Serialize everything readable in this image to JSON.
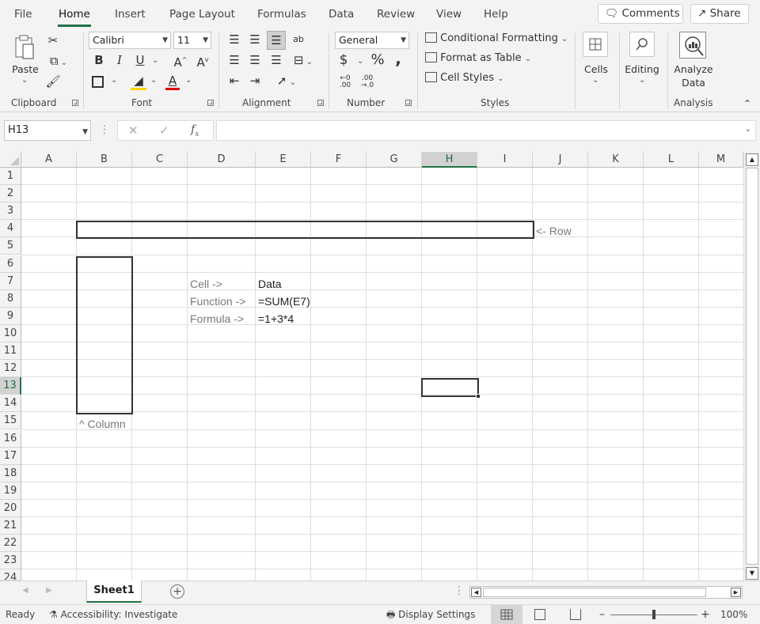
{
  "menu_tabs": [
    "File",
    "Home",
    "Insert",
    "Page Layout",
    "Formulas",
    "Data",
    "Review",
    "View",
    "Help"
  ],
  "top_buttons": {
    "comments": "Comments",
    "share": "Share"
  },
  "ribbon": {
    "clipboard": {
      "label": "Clipboard",
      "paste": "Paste"
    },
    "font": {
      "label": "Font",
      "family": "Calibri",
      "size": "11",
      "bold": "B",
      "italic": "I",
      "underline": "U"
    },
    "alignment": {
      "label": "Alignment"
    },
    "number": {
      "label": "Number",
      "format": "General",
      "currency": "$",
      "percent": "%",
      "comma": ","
    },
    "styles": {
      "label": "Styles",
      "conditional": "Conditional Formatting",
      "table": "Format as Table",
      "cell_styles": "Cell Styles"
    },
    "cells": {
      "label": "Cells"
    },
    "editing": {
      "label": "Editing"
    },
    "analysis": {
      "label": "Analysis",
      "analyze_line1": "Analyze",
      "analyze_line2": "Data"
    }
  },
  "formula_bar": {
    "name_box": "H13",
    "formula": ""
  },
  "grid": {
    "columns": [
      "A",
      "B",
      "C",
      "D",
      "E",
      "F",
      "G",
      "H",
      "I",
      "J",
      "K",
      "L",
      "M"
    ],
    "rows": [
      "1",
      "2",
      "3",
      "4",
      "5",
      "6",
      "7",
      "8",
      "9",
      "10",
      "11",
      "12",
      "13",
      "14",
      "15",
      "16",
      "17",
      "18",
      "19",
      "20",
      "21",
      "22",
      "23",
      "24"
    ],
    "selected_cell": "H13",
    "annotations": {
      "row": "<- Row",
      "column": "^ Column"
    },
    "cells": {
      "D7": "Cell ->",
      "E7": "Data",
      "D8": "Function ->",
      "E8": "=SUM(E7)",
      "D9": "Formula ->",
      "E9": "=1+3*4"
    }
  },
  "sheets": [
    "Sheet1"
  ],
  "status": {
    "ready": "Ready",
    "accessibility": "Accessibility: Investigate",
    "display_settings": "Display Settings",
    "zoom": "100%"
  },
  "colors": {
    "accent": "#217346",
    "gridline": "#dedede",
    "header_bg": "#f3f3f3"
  },
  "icons": [
    "cut-icon",
    "copy-icon",
    "format-painter-icon",
    "borders-icon",
    "fill-color-icon",
    "font-color-icon",
    "wrap-text-icon",
    "merge-icon",
    "orientation-icon",
    "decrease-decimal-icon",
    "increase-decimal-icon",
    "cells-icon",
    "search-icon",
    "analyze-icon",
    "fx-icon",
    "collapse-icon",
    "add-sheet-icon",
    "normal-view-icon",
    "page-layout-icon",
    "page-break-icon"
  ]
}
